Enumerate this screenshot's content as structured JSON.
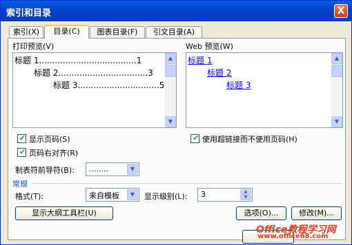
{
  "window": {
    "title": "索引和目录",
    "close_label": "X"
  },
  "tabs": [
    {
      "label": "索引(X)"
    },
    {
      "label": "目录(C)"
    },
    {
      "label": "图表目录(F)"
    },
    {
      "label": "引文目录(A)"
    }
  ],
  "print_preview": {
    "label": "打印预览(V)",
    "entries": [
      {
        "text": "标题 1",
        "dots": ".....................................",
        "page": "1"
      },
      {
        "text": "标题 2",
        "dots": "..................................",
        "page": "3"
      },
      {
        "text": "标题 3",
        "dots": "...............................",
        "page": "5"
      }
    ]
  },
  "web_preview": {
    "label": "Web 预览(W)",
    "entries": [
      "标题 1",
      "标题 2",
      "标题 3"
    ]
  },
  "options": {
    "show_page_numbers": {
      "label": "显示页码(S)",
      "checked": true
    },
    "right_align_page_numbers": {
      "label": "页码右对齐(R)",
      "checked": true
    },
    "use_hyperlinks": {
      "label": "使用超链接而不使用页码(H)",
      "checked": true
    },
    "tab_leader": {
      "label": "制表符前导符(B):",
      "value": "........"
    }
  },
  "general": {
    "label": "常规",
    "format_label": "格式(T):",
    "format_value": "来自模板",
    "show_levels_label": "显示级别(L):",
    "show_levels_value": "3"
  },
  "buttons": {
    "outline_toolbar": "显示大纲工具栏(U)",
    "options": "选项(O)...",
    "modify": "修改(M)..."
  },
  "watermark": {
    "line1": "Office教程学习网",
    "line2": "www.office68.com"
  },
  "colors": {
    "title_bar": "#0a5fdc",
    "link": "#0000ff",
    "check": "#21a121"
  }
}
